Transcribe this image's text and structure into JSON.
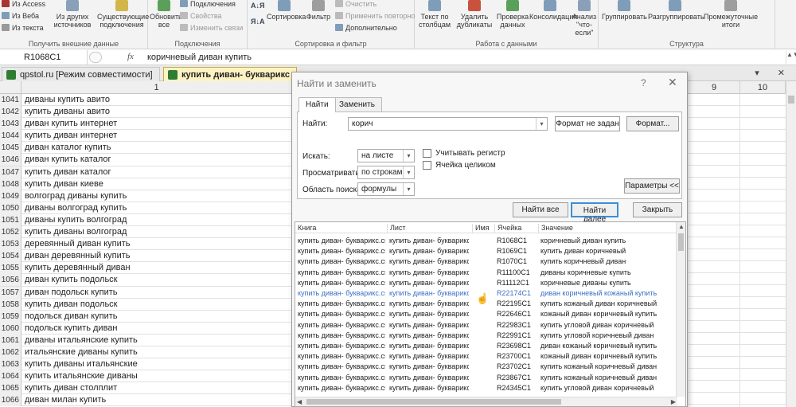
{
  "ribbon": {
    "external": {
      "access": "Из Access",
      "web": "Из Веба",
      "text": "Из текста",
      "other": "Из других источников",
      "existing": "Существующие подключения",
      "group": "Получить внешние данные"
    },
    "connections": {
      "refresh": "Обновить все",
      "conn": "Подключения",
      "props": "Свойства",
      "editlinks": "Изменить связи",
      "group": "Подключения"
    },
    "sortfilter": {
      "sort": "Сортировка",
      "filter": "Фильтр",
      "clear": "Очистить",
      "reapply": "Применить повторно",
      "advanced": "Дополнительно",
      "group": "Сортировка и фильтр"
    },
    "datatools": {
      "textcols": "Текст по столбцам",
      "remdup": "Удалить дубликаты",
      "validate": "Проверка данных",
      "consolidate": "Консолидация",
      "whatif": "Анализ \"что-если\"",
      "group": "Работа с данными"
    },
    "outline": {
      "group_btn": "Группировать",
      "ungroup": "Разгруппировать",
      "subtotal": "Промежуточные итоги",
      "group": "Структура"
    }
  },
  "formulabar": {
    "namebox": "R1068C1",
    "fx": "fx",
    "formula": "коричневый диван купить"
  },
  "tabs": [
    {
      "label": "qpstol.ru  [Режим совместимости]"
    },
    {
      "label": "купить диван- букварикс"
    }
  ],
  "columns": {
    "c1": "1",
    "c9": "9",
    "c10": "10"
  },
  "rows": [
    {
      "n": "1041",
      "v": "диваны купить авито"
    },
    {
      "n": "1042",
      "v": "купить диваны авито"
    },
    {
      "n": "1043",
      "v": "диван купить интернет"
    },
    {
      "n": "1044",
      "v": "купить диван интернет"
    },
    {
      "n": "1045",
      "v": "диван каталог купить"
    },
    {
      "n": "1046",
      "v": "диван купить каталог"
    },
    {
      "n": "1047",
      "v": "купить диван каталог"
    },
    {
      "n": "1048",
      "v": "купить диван киеве"
    },
    {
      "n": "1049",
      "v": "волгоград диваны купить"
    },
    {
      "n": "1050",
      "v": "диваны волгоград купить"
    },
    {
      "n": "1051",
      "v": "диваны купить волгоград"
    },
    {
      "n": "1052",
      "v": "купить диваны волгоград"
    },
    {
      "n": "1053",
      "v": "деревянный диван купить"
    },
    {
      "n": "1054",
      "v": "диван деревянный купить"
    },
    {
      "n": "1055",
      "v": "купить деревянный диван"
    },
    {
      "n": "1056",
      "v": "диван купить подольск"
    },
    {
      "n": "1057",
      "v": "диван подольск купить"
    },
    {
      "n": "1058",
      "v": "купить диван подольск"
    },
    {
      "n": "1059",
      "v": "подольск диван купить"
    },
    {
      "n": "1060",
      "v": "подольск купить диван"
    },
    {
      "n": "1061",
      "v": "диваны итальянские купить"
    },
    {
      "n": "1062",
      "v": "итальянские диваны купить"
    },
    {
      "n": "1063",
      "v": "купить диваны итальянские"
    },
    {
      "n": "1064",
      "v": "купить итальянские диваны"
    },
    {
      "n": "1065",
      "v": "купить диван столплит"
    },
    {
      "n": "1066",
      "v": "диван милан купить"
    }
  ],
  "dialog": {
    "title": "Найти и заменить",
    "help": "?",
    "close": "✕",
    "tab_find": "Найти",
    "tab_replace": "Заменить",
    "find_label": "Найти:",
    "find_value": "корич",
    "format_not_set": "Формат не задан",
    "format_btn": "Формат...",
    "within_label": "Искать:",
    "within_value": "на листе",
    "search_label": "Просматривать:",
    "search_value": "по строкам",
    "lookin_label": "Область поиска:",
    "lookin_value": "формулы",
    "match_case": "Учитывать регистр",
    "whole_cell": "Ячейка целиком",
    "params_btn": "Параметры <<",
    "find_all": "Найти все",
    "find_next": "Найти далее",
    "close_btn": "Закрыть",
    "headers": {
      "book": "Книга",
      "sheet": "Лист",
      "name": "Имя",
      "cell": "Ячейка",
      "value": "Значение"
    },
    "results": [
      {
        "book": "купить диван- букварикс.csv",
        "sheet": "купить диван- букварикс",
        "cell": "R1068C1",
        "value": "коричневый диван купить"
      },
      {
        "book": "купить диван- букварикс.csv",
        "sheet": "купить диван- букварикс",
        "cell": "R1069C1",
        "value": "купить диван коричневый"
      },
      {
        "book": "купить диван- букварикс.csv",
        "sheet": "купить диван- букварикс",
        "cell": "R1070C1",
        "value": "купить коричневый диван"
      },
      {
        "book": "купить диван- букварикс.csv",
        "sheet": "купить диван- букварикс",
        "cell": "R11100C1",
        "value": "диваны коричневые купить"
      },
      {
        "book": "купить диван- букварикс.csv",
        "sheet": "купить диван- букварикс",
        "cell": "R11112C1",
        "value": "коричневые диваны купить"
      },
      {
        "book": "купить диван- букварикс.csv",
        "sheet": "купить диван- букварикс",
        "cell": "R22174C1",
        "value": "диван коричневый кожаный купить"
      },
      {
        "book": "купить диван- букварикс.csv",
        "sheet": "купить диван- букварикс",
        "cell": "R22195C1",
        "value": "купить кожаный диван коричневый"
      },
      {
        "book": "купить диван- букварикс.csv",
        "sheet": "купить диван- букварикс",
        "cell": "R22646C1",
        "value": "кожаный диван коричневый купить"
      },
      {
        "book": "купить диван- букварикс.csv",
        "sheet": "купить диван- букварикс",
        "cell": "R22983C1",
        "value": "купить угловой диван коричневый"
      },
      {
        "book": "купить диван- букварикс.csv",
        "sheet": "купить диван- букварикс",
        "cell": "R22991C1",
        "value": "купить угловой коричневый диван"
      },
      {
        "book": "купить диван- букварикс.csv",
        "sheet": "купить диван- букварикс",
        "cell": "R23698C1",
        "value": "диван кожаный коричневый купить"
      },
      {
        "book": "купить диван- букварикс.csv",
        "sheet": "купить диван- букварикс",
        "cell": "R23700C1",
        "value": "кожаный диван коричневый купить"
      },
      {
        "book": "купить диван- букварикс.csv",
        "sheet": "купить диван- букварикс",
        "cell": "R23702C1",
        "value": "купить кожаный коричневый диван"
      },
      {
        "book": "купить диван- букварикс.csv",
        "sheet": "купить диван- букварикс",
        "cell": "R23867C1",
        "value": "купить кожаный коричневый диван"
      },
      {
        "book": "купить диван- букварикс.csv",
        "sheet": "купить диван- букварикс",
        "cell": "R24345C1",
        "value": "купить угловой диван коричневый"
      }
    ]
  },
  "colors": {
    "highlight_link": "#3b6fc4",
    "active_tab": "#fdf3c2",
    "excel_green": "#2e7d32"
  }
}
